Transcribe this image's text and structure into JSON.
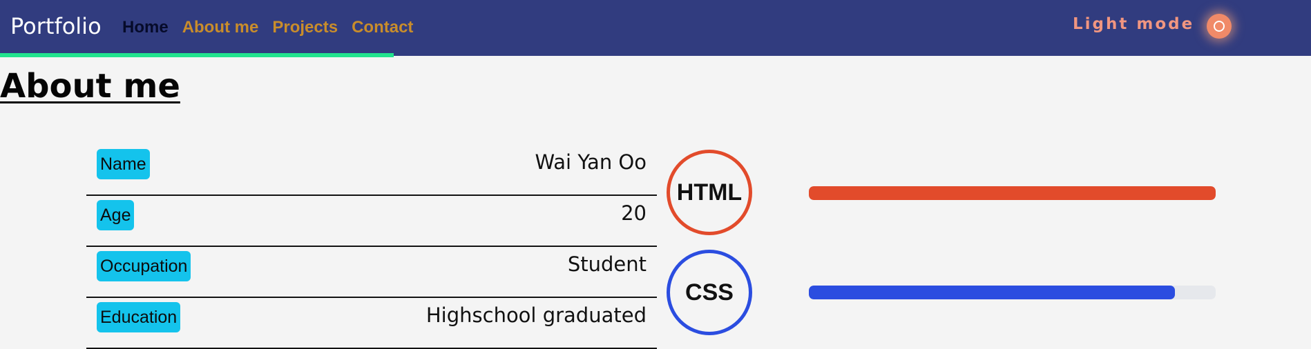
{
  "header": {
    "brand": "Portfolio",
    "nav": [
      {
        "label": "Home",
        "active": true
      },
      {
        "label": "About me",
        "active": false
      },
      {
        "label": "Projects",
        "active": false
      },
      {
        "label": "Contact",
        "active": false
      }
    ],
    "mode_label": "Light mode",
    "mode_icon": "sun-icon"
  },
  "page": {
    "title": "About me"
  },
  "info": [
    {
      "key": "Name",
      "value": "Wai Yan Oo"
    },
    {
      "key": "Age",
      "value": "20"
    },
    {
      "key": "Occupation",
      "value": "Student"
    },
    {
      "key": "Education",
      "value": "Highschool graduated"
    }
  ],
  "skills": [
    {
      "name": "HTML",
      "progress": 1.0,
      "color": "#e24b2b"
    },
    {
      "name": "CSS",
      "progress": 0.9,
      "color": "#2b4de0"
    }
  ],
  "colors": {
    "nav_bg": "#313c7f",
    "accent_line": "#22e38e",
    "key_badge": "#14c3ec"
  }
}
